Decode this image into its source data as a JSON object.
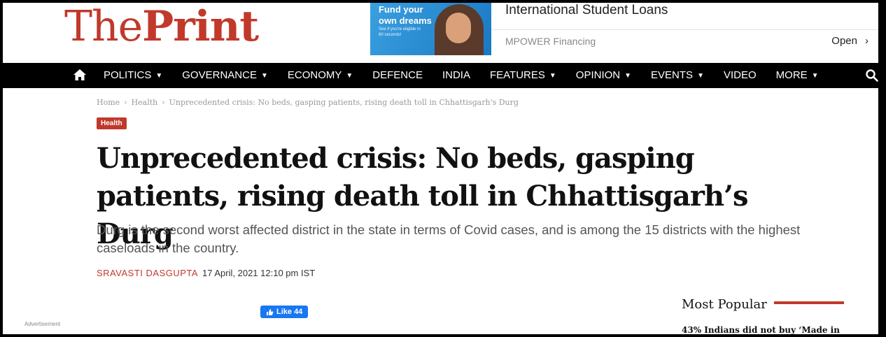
{
  "header": {
    "logo_the": "The",
    "logo_print": "Print"
  },
  "ad": {
    "image_line1": "Fund your",
    "image_line2": "own dreams",
    "image_small": "See if you're eligible in 60 seconds!",
    "title": "International Student Loans",
    "sponsor": "MPOWER Financing",
    "cta": "Open"
  },
  "nav": {
    "items": [
      {
        "label": "POLITICS",
        "dropdown": true
      },
      {
        "label": "GOVERNANCE",
        "dropdown": true
      },
      {
        "label": "ECONOMY",
        "dropdown": true
      },
      {
        "label": "DEFENCE",
        "dropdown": false
      },
      {
        "label": "INDIA",
        "dropdown": false
      },
      {
        "label": "FEATURES",
        "dropdown": true
      },
      {
        "label": "OPINION",
        "dropdown": true
      },
      {
        "label": "EVENTS",
        "dropdown": true
      },
      {
        "label": "VIDEO",
        "dropdown": false
      },
      {
        "label": "MORE",
        "dropdown": true
      }
    ],
    "home_icon": "home-icon",
    "search_icon": "search-icon"
  },
  "breadcrumb": {
    "home": "Home",
    "section": "Health",
    "current": "Unprecedented crisis: No beds, gasping patients, rising death toll in Chhattisgarh's Durg"
  },
  "article": {
    "tag": "Health",
    "headline": "Unprecedented crisis: No beds, gasping patients, rising death toll in Chhattisgarh’s Durg",
    "dek": "Durg is the second worst affected district in the state in terms of Covid cases, and is among the 15 districts with the highest caseloads in the country.",
    "author": "Sravasti Dasgupta",
    "date": "17 April, 2021 12:10 pm IST"
  },
  "social": {
    "fb_like": "Like 44"
  },
  "advertisement_label": "Advertisement",
  "sidebar": {
    "title": "Most Popular",
    "first_item": "43% Indians did not buy ‘Made in"
  },
  "colors": {
    "brand": "#c0392b",
    "nav_bg": "#000000",
    "facebook": "#1877f2"
  }
}
